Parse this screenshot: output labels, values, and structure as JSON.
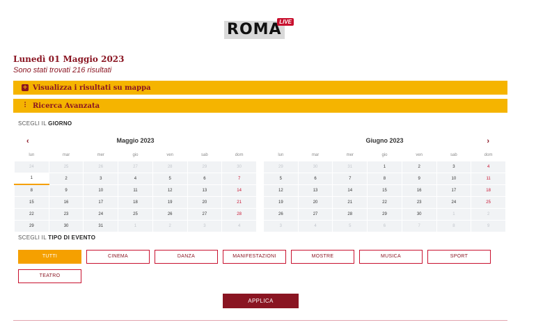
{
  "logo": {
    "word": "ROMA",
    "badge": "LIVE"
  },
  "header": {
    "date_title": "Lunedì 01 Maggio 2023",
    "results_text": "Sono stati trovati  216  risultati"
  },
  "bars": {
    "map_label": "Visualizza i risultati su mappa",
    "advanced_label": "Ricerca Avanzata"
  },
  "day_section": {
    "prefix": "SCEGLI IL ",
    "strong": "GIORNO"
  },
  "weekdays": [
    "lun",
    "mar",
    "mer",
    "gio",
    "ven",
    "sab",
    "dom"
  ],
  "calendars": [
    {
      "title": "Maggio 2023",
      "weeks": [
        [
          "24",
          "25",
          "26",
          "27",
          "28",
          "29",
          "30"
        ],
        [
          "1",
          "2",
          "3",
          "4",
          "5",
          "6",
          "7"
        ],
        [
          "8",
          "9",
          "10",
          "11",
          "12",
          "13",
          "14"
        ],
        [
          "15",
          "16",
          "17",
          "18",
          "19",
          "20",
          "21"
        ],
        [
          "22",
          "23",
          "24",
          "25",
          "26",
          "27",
          "28"
        ],
        [
          "29",
          "30",
          "31",
          "1",
          "2",
          "3",
          "4"
        ]
      ]
    },
    {
      "title": "Giugno 2023",
      "weeks": [
        [
          "29",
          "30",
          "31",
          "1",
          "2",
          "3",
          "4"
        ],
        [
          "5",
          "6",
          "7",
          "8",
          "9",
          "10",
          "11"
        ],
        [
          "12",
          "13",
          "14",
          "15",
          "16",
          "17",
          "18"
        ],
        [
          "19",
          "20",
          "21",
          "22",
          "23",
          "24",
          "25"
        ],
        [
          "26",
          "27",
          "28",
          "29",
          "30",
          "1",
          "2"
        ],
        [
          "3",
          "4",
          "5",
          "6",
          "7",
          "8",
          "9"
        ]
      ]
    }
  ],
  "type_section": {
    "prefix": "SCEGLI IL ",
    "strong": "TIPO DI EVENTO"
  },
  "event_types": [
    "TUTTI",
    "CINEMA",
    "DANZA",
    "MANIFESTAZIONI",
    "MOSTRE",
    "MUSICA",
    "SPORT",
    "TEATRO"
  ],
  "apply_label": "APPLICA",
  "colors": {
    "accent": "#f5b400",
    "brand": "#8a1522",
    "red": "#c8102e"
  }
}
